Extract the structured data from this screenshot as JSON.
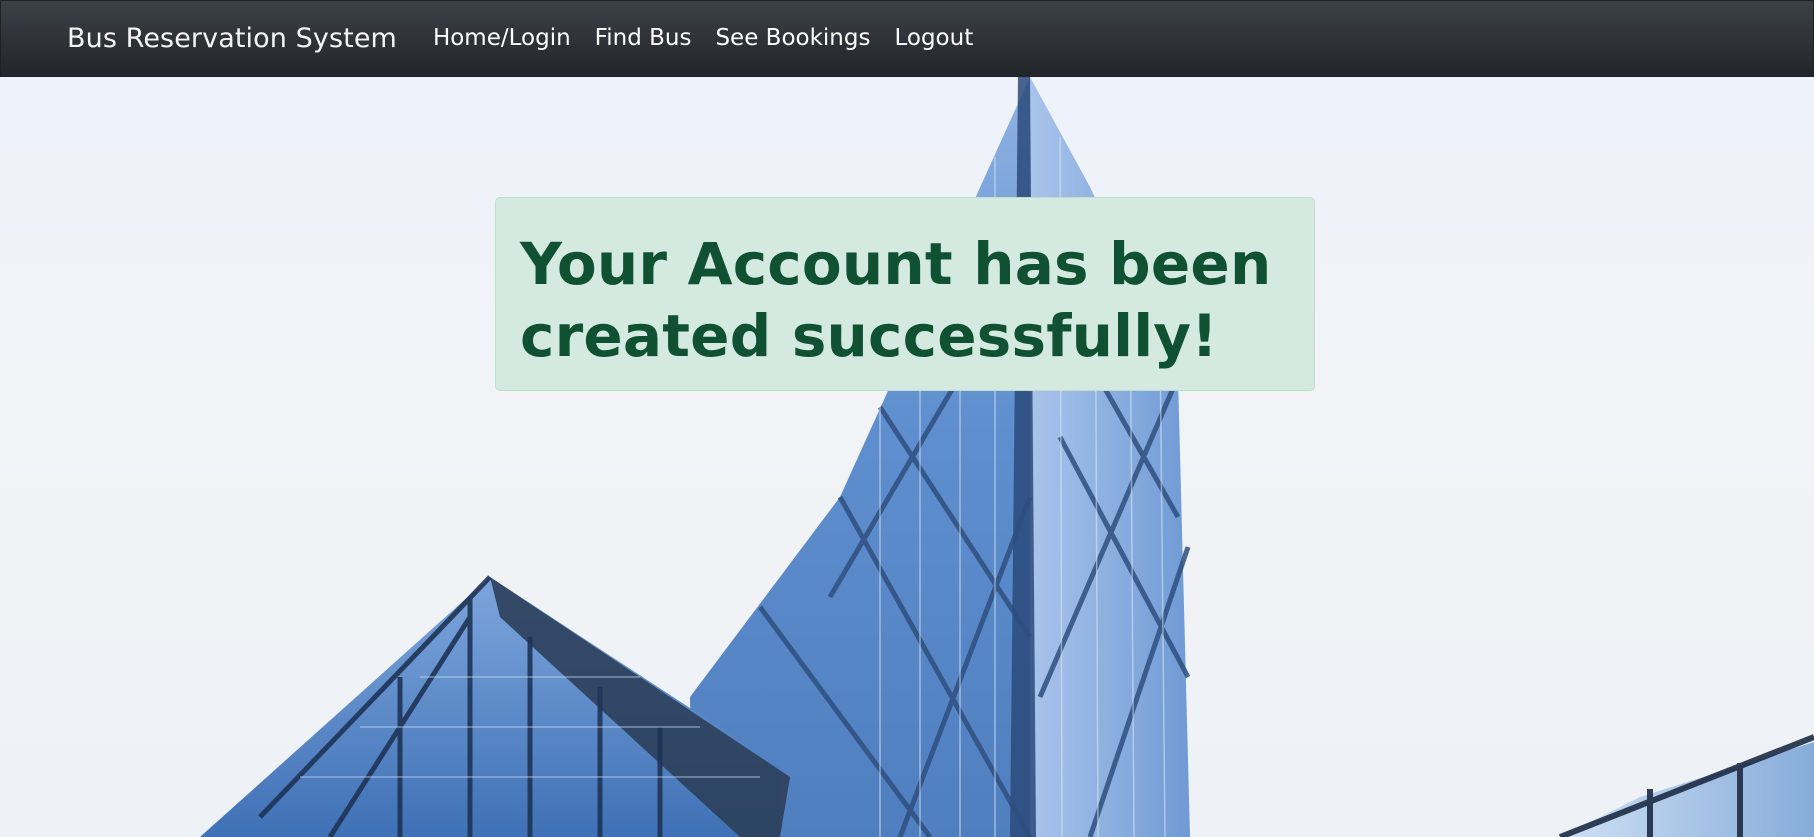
{
  "navbar": {
    "brand": "Bus Reservation System",
    "links": [
      {
        "label": "Home/Login"
      },
      {
        "label": "Find Bus"
      },
      {
        "label": "See Bookings"
      },
      {
        "label": "Logout"
      }
    ],
    "colors": {
      "background": "#2b2f34",
      "text": "#ffffff"
    }
  },
  "alert": {
    "message": "Your Account has been created successfully!",
    "colors": {
      "background": "#d4e9df",
      "border": "#bddfcc",
      "text": "#0f5132"
    }
  },
  "hero": {
    "image": "glass-skyscrapers-photo"
  }
}
